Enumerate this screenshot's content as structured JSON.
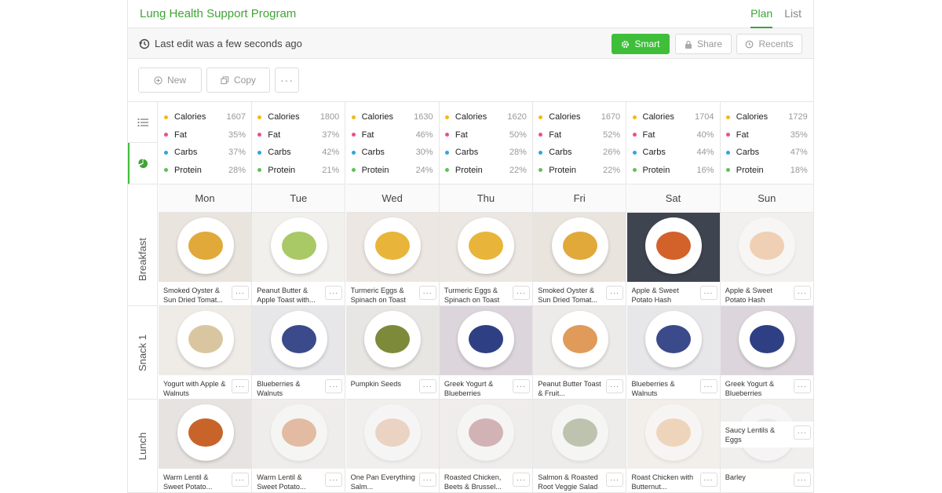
{
  "app": {
    "title": "Lung Health Support Program"
  },
  "view_tabs": [
    {
      "label": "Plan"
    },
    {
      "label": "List"
    }
  ],
  "toolbar": {
    "last_edit": "Last edit was a few seconds ago",
    "smart_label": "Smart",
    "share_label": "Share",
    "recents_label": "Recents"
  },
  "actions": {
    "new_label": "New",
    "copy_label": "Copy",
    "more_label": "···"
  },
  "nutrient_colors": {
    "Calories": "#f5b915",
    "Fat": "#ef4f86",
    "Carbs": "#2aa7e0",
    "Protein": "#5fc256"
  },
  "days": [
    {
      "name": "Mon",
      "nutrition": [
        {
          "label": "Calories",
          "value": "1607"
        },
        {
          "label": "Fat",
          "value": "35%"
        },
        {
          "label": "Carbs",
          "value": "37%"
        },
        {
          "label": "Protein",
          "value": "28%"
        }
      ]
    },
    {
      "name": "Tue",
      "nutrition": [
        {
          "label": "Calories",
          "value": "1800"
        },
        {
          "label": "Fat",
          "value": "37%"
        },
        {
          "label": "Carbs",
          "value": "42%"
        },
        {
          "label": "Protein",
          "value": "21%"
        }
      ]
    },
    {
      "name": "Wed",
      "nutrition": [
        {
          "label": "Calories",
          "value": "1630"
        },
        {
          "label": "Fat",
          "value": "46%"
        },
        {
          "label": "Carbs",
          "value": "30%"
        },
        {
          "label": "Protein",
          "value": "24%"
        }
      ]
    },
    {
      "name": "Thu",
      "nutrition": [
        {
          "label": "Calories",
          "value": "1620"
        },
        {
          "label": "Fat",
          "value": "50%"
        },
        {
          "label": "Carbs",
          "value": "28%"
        },
        {
          "label": "Protein",
          "value": "22%"
        }
      ]
    },
    {
      "name": "Fri",
      "nutrition": [
        {
          "label": "Calories",
          "value": "1670"
        },
        {
          "label": "Fat",
          "value": "52%"
        },
        {
          "label": "Carbs",
          "value": "26%"
        },
        {
          "label": "Protein",
          "value": "22%"
        }
      ]
    },
    {
      "name": "Sat",
      "nutrition": [
        {
          "label": "Calories",
          "value": "1704"
        },
        {
          "label": "Fat",
          "value": "40%"
        },
        {
          "label": "Carbs",
          "value": "44%"
        },
        {
          "label": "Protein",
          "value": "16%"
        }
      ]
    },
    {
      "name": "Sun",
      "nutrition": [
        {
          "label": "Calories",
          "value": "1729"
        },
        {
          "label": "Fat",
          "value": "35%"
        },
        {
          "label": "Carbs",
          "value": "47%"
        },
        {
          "label": "Protein",
          "value": "18%"
        }
      ]
    }
  ],
  "meals": [
    {
      "label": "Breakfast",
      "items": [
        {
          "name": "Smoked Oyster & Sun Dried Tomat...",
          "bg": "#e9e4dd",
          "food": "#e0a93a",
          "faded": false
        },
        {
          "name": "Peanut Butter & Apple Toast with...",
          "bg": "#f2f0ec",
          "food": "#a9c866",
          "faded": false
        },
        {
          "name": "Turmeric Eggs & Spinach on Toast",
          "bg": "#ece7e2",
          "food": "#e8b53a",
          "faded": false
        },
        {
          "name": "Turmeric Eggs & Spinach on Toast",
          "bg": "#ece7e2",
          "food": "#e8b53a",
          "faded": false
        },
        {
          "name": "Smoked Oyster & Sun Dried Tomat...",
          "bg": "#e9e4dd",
          "food": "#e0a93a",
          "faded": false
        },
        {
          "name": "Apple & Sweet Potato Hash",
          "bg": "#3e4450",
          "food": "#d2622a",
          "faded": false
        },
        {
          "name": "Apple & Sweet Potato Hash",
          "bg": "#f1efee",
          "food": "#e29a55",
          "faded": true
        }
      ]
    },
    {
      "label": "Snack 1",
      "items": [
        {
          "name": "Yogurt with Apple & Walnuts",
          "bg": "#efece8",
          "food": "#d9c6a0",
          "faded": false
        },
        {
          "name": "Blueberries & Walnuts",
          "bg": "#e7e7e9",
          "food": "#3a4a8a",
          "faded": false
        },
        {
          "name": "Pumpkin Seeds",
          "bg": "#e8e6e3",
          "food": "#7c8a3a",
          "faded": false
        },
        {
          "name": "Greek Yogurt & Blueberries",
          "bg": "#dcd6dc",
          "food": "#2f3f84",
          "faded": false
        },
        {
          "name": "Peanut Butter Toast & Fruit...",
          "bg": "#ecebea",
          "food": "#e09a5a",
          "faded": false
        },
        {
          "name": "Blueberries & Walnuts",
          "bg": "#e7e7e9",
          "food": "#3a4a8a",
          "faded": false
        },
        {
          "name": "Greek Yogurt & Blueberries",
          "bg": "#dcd6dc",
          "food": "#2f3f84",
          "faded": false
        }
      ]
    },
    {
      "label": "Lunch",
      "items": [
        {
          "name": "Warm Lentil & Sweet Potato...",
          "bg": "#e6e3e0",
          "food": "#c8642a",
          "faded": false
        },
        {
          "name": "Warm Lentil & Sweet Potato...",
          "bg": "#eeecea",
          "food": "#c8642a",
          "faded": true
        },
        {
          "name": "One Pan Everything Salm...",
          "bg": "#f0eeec",
          "food": "#d8a17a",
          "faded": true
        },
        {
          "name": "Roasted Chicken, Beets & Brussel...",
          "bg": "#eeecea",
          "food": "#a0505a",
          "faded": true
        },
        {
          "name": "Salmon & Roasted Root Veggie Salad",
          "bg": "#edebe9",
          "food": "#6a7a4a",
          "faded": true
        },
        {
          "name": "Roast Chicken with Butternut...",
          "bg": "#f1ede8",
          "food": "#e3a46a",
          "faded": true
        },
        {
          "name": "Barley",
          "bg": "#f0eeec",
          "food": "#ddd7cc",
          "faded": true,
          "overlay": "Saucy Lentils & Eggs"
        }
      ]
    }
  ],
  "more_icon": "···"
}
